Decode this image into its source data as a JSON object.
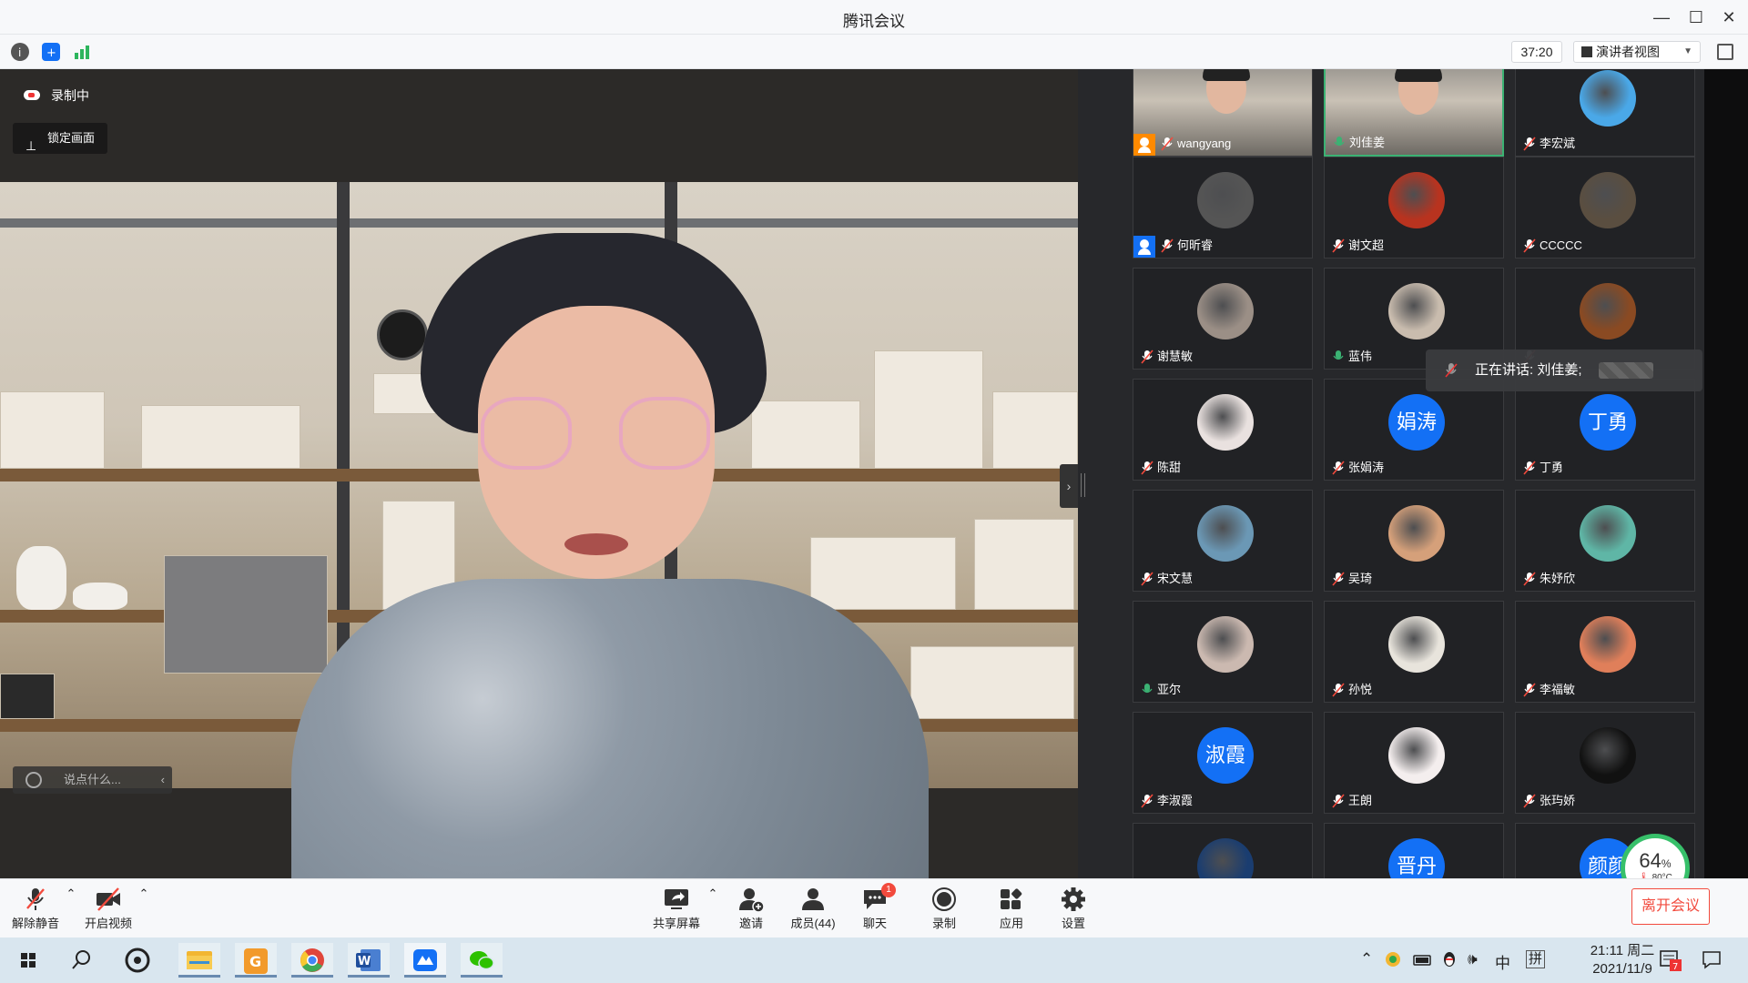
{
  "window": {
    "title": "腾讯会议",
    "controls": [
      "minimize-icon",
      "maximize-icon",
      "close-icon"
    ]
  },
  "infobar": {
    "timer": "37:20",
    "view_label": "演讲者视图",
    "icons": [
      "info-icon",
      "shield-icon",
      "signal-icon",
      "fullscreen-icon"
    ]
  },
  "main": {
    "recording_label": "录制中",
    "lock_label": "锁定画面",
    "chat_placeholder": "说点什么..."
  },
  "speaking": {
    "prefix": "正在讲话: 刘佳姜;"
  },
  "participants": [
    {
      "name": "wangyang",
      "type": "camera",
      "muted": true,
      "host": "orange"
    },
    {
      "name": "刘佳姜",
      "type": "camera",
      "muted": false,
      "active": true
    },
    {
      "name": "李宏斌",
      "type": "photo",
      "muted": true,
      "color": "#4aa8e8"
    },
    {
      "name": "何昕睿",
      "type": "photo",
      "muted": true,
      "host": "blue",
      "color": "#555"
    },
    {
      "name": "谢文超",
      "type": "photo",
      "muted": true,
      "color": "#b8331f"
    },
    {
      "name": "CCCCC",
      "type": "photo",
      "muted": true,
      "color": "#5a4e40"
    },
    {
      "name": "谢慧敏",
      "type": "photo",
      "muted": true,
      "color": "#9b8f86"
    },
    {
      "name": "蓝伟",
      "type": "photo",
      "muted": false,
      "color": "#c9bcae"
    },
    {
      "name": "",
      "type": "photo",
      "muted": true,
      "color": "#8a4a22"
    },
    {
      "name": "陈甜",
      "type": "photo",
      "muted": true,
      "color": "#e9e1df"
    },
    {
      "name": "张娟涛",
      "type": "text",
      "muted": true,
      "avatar_text": "娟涛"
    },
    {
      "name": "丁勇",
      "type": "text",
      "muted": true,
      "avatar_text": "丁勇"
    },
    {
      "name": "宋文慧",
      "type": "photo",
      "muted": true,
      "color": "#6b98b5"
    },
    {
      "name": "吴琦",
      "type": "photo",
      "muted": true,
      "color": "#d5a07a"
    },
    {
      "name": "朱妤欣",
      "type": "photo",
      "muted": true,
      "color": "#5fb6a6"
    },
    {
      "name": "亚尔",
      "type": "photo",
      "muted": false,
      "color": "#cbb9b0"
    },
    {
      "name": "孙悦",
      "type": "photo",
      "muted": true,
      "color": "#e8e4dc"
    },
    {
      "name": "李福敏",
      "type": "photo",
      "muted": true,
      "color": "#e07f5a"
    },
    {
      "name": "李淑霞",
      "type": "text",
      "muted": true,
      "avatar_text": "淑霞"
    },
    {
      "name": "王朗",
      "type": "photo",
      "muted": true,
      "color": "#f4eeee"
    },
    {
      "name": "张玙娇",
      "type": "photo",
      "muted": true,
      "color": "#111111"
    },
    {
      "name": "",
      "type": "photo",
      "muted": false,
      "color": "#1a3d70"
    },
    {
      "name": "",
      "type": "text",
      "muted": false,
      "avatar_text": "晋丹"
    },
    {
      "name": "",
      "type": "text",
      "muted": false,
      "avatar_text": "颜颜"
    }
  ],
  "cpu": {
    "percent": "64",
    "percent_sign": "%",
    "temp": "80°C"
  },
  "toolbar": {
    "unmute": "解除静音",
    "video": "开启视频",
    "share": "共享屏幕",
    "invite": "邀请",
    "members": "成员(44)",
    "chat": "聊天",
    "chat_badge": "1",
    "record": "录制",
    "apps": "应用",
    "settings": "设置",
    "leave": "离开会议"
  },
  "taskbar": {
    "ime": "中",
    "ime2": "拼",
    "time": "21:11 周二",
    "date": "2021/11/9",
    "notif_count": "7"
  },
  "colors": {
    "accent": "#1370f5",
    "danger": "#f24a3d",
    "active": "#3bb273"
  }
}
